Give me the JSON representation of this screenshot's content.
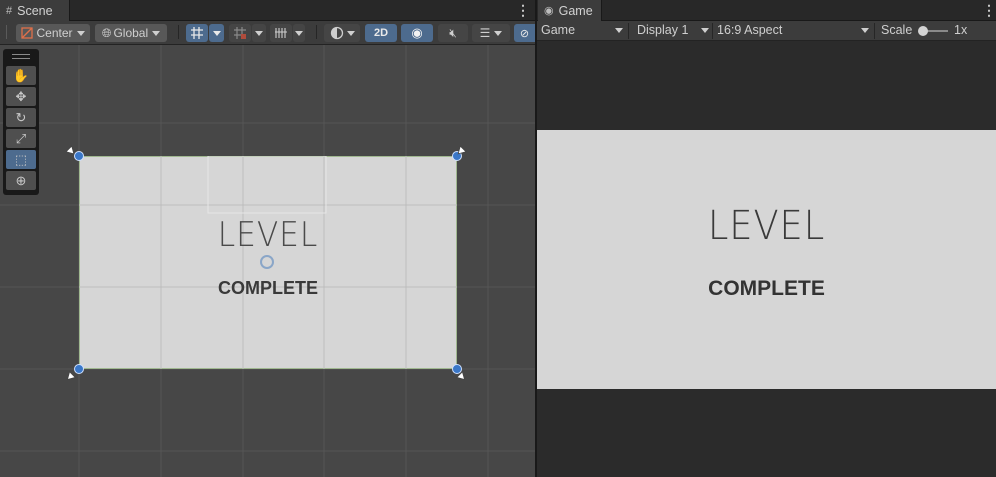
{
  "scene_tab": {
    "title": "Scene",
    "icon": "#"
  },
  "game_tab": {
    "title": "Game",
    "icon": "◉"
  },
  "scene_toolbar": {
    "pivot_label": "Center",
    "space_label": "Global",
    "mode_2d_label": "2D"
  },
  "game_toolbar": {
    "view_label": "Game",
    "display_label": "Display 1",
    "aspect_label": "16:9 Aspect",
    "scale_label": "Scale",
    "scale_value": "1x"
  },
  "tools": [
    {
      "name": "hand-tool",
      "glyph": "✋"
    },
    {
      "name": "move-tool",
      "glyph": "✥"
    },
    {
      "name": "rotate-tool",
      "glyph": "↻"
    },
    {
      "name": "scale-tool",
      "glyph": "⤢"
    },
    {
      "name": "rect-tool",
      "glyph": "⬚"
    },
    {
      "name": "transform-tool",
      "glyph": "⊕"
    }
  ],
  "level_text": {
    "title": "LEVEL",
    "subtitle": "COMPLETE"
  },
  "colors": {
    "accent": "#4d6b8e",
    "canvas": "#d6d6d6",
    "handle": "#3a77c8",
    "scene_bg": "#474747",
    "game_bg": "#2b2b2b"
  }
}
